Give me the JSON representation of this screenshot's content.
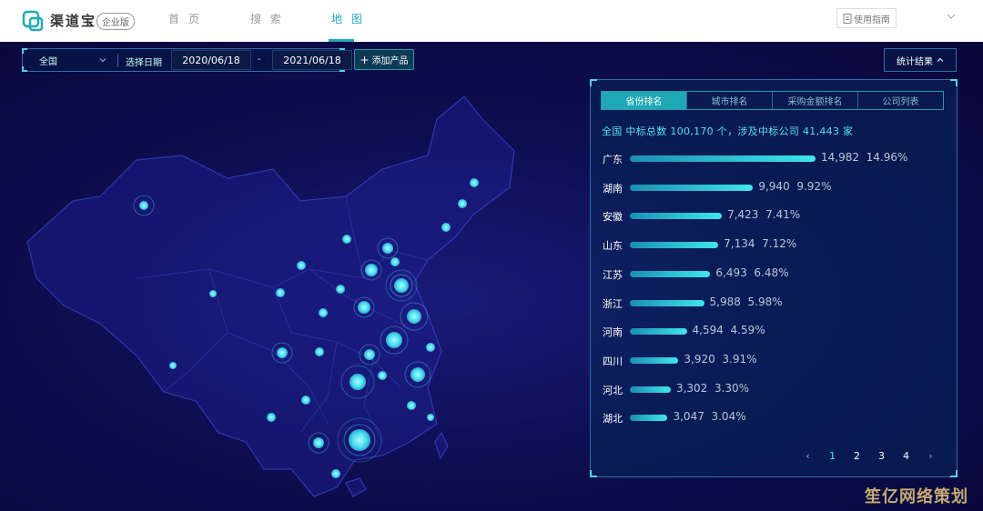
{
  "app": {
    "logo_text": "渠道宝",
    "badge": "企业版",
    "nav": [
      "首 页",
      "搜 索",
      "地 图"
    ],
    "active_nav": 2,
    "help": "使用指南",
    "accent": "#1fa9b5"
  },
  "filters": {
    "region": "全国",
    "date_label": "选择日期",
    "date_start": "2020/06/18",
    "date_sep": "-",
    "date_end": "2021/06/18",
    "add_button": "添加产品",
    "stats_button": "统计结果"
  },
  "panel": {
    "tabs": [
      "省份排名",
      "城市排名",
      "采购金额排名",
      "公司列表"
    ],
    "active_tab": 0,
    "summary": "全国 中标总数 100,170 个，涉及中标公司 41,443 家",
    "rows": [
      {
        "name": "广东",
        "count": "14,982",
        "pct": "14.96%",
        "value": 14982
      },
      {
        "name": "湖南",
        "count": "9,940",
        "pct": "9.92%",
        "value": 9940
      },
      {
        "name": "安徽",
        "count": "7,423",
        "pct": "7.41%",
        "value": 7423
      },
      {
        "name": "山东",
        "count": "7,134",
        "pct": "7.12%",
        "value": 7134
      },
      {
        "name": "江苏",
        "count": "6,493",
        "pct": "6.48%",
        "value": 6493
      },
      {
        "name": "浙江",
        "count": "5,988",
        "pct": "5.98%",
        "value": 5988
      },
      {
        "name": "河南",
        "count": "4,594",
        "pct": "4.59%",
        "value": 4594
      },
      {
        "name": "四川",
        "count": "3,920",
        "pct": "3.91%",
        "value": 3920
      },
      {
        "name": "河北",
        "count": "3,302",
        "pct": "3.30%",
        "value": 3302
      },
      {
        "name": "湖北",
        "count": "3,047",
        "pct": "3.04%",
        "value": 3047
      }
    ],
    "pager": {
      "prev": "‹",
      "pages": [
        "1",
        "2",
        "3",
        "4"
      ],
      "active": 0,
      "next": "›"
    }
  },
  "icons": {
    "logo": "logo-icon",
    "help": "document-icon",
    "nav_chevron": "chevron-down-icon",
    "region_chevron": "chevron-down-icon",
    "add": "plus-icon",
    "stats": "chevron-up-icon"
  },
  "watermark": "笙亿网络策划"
}
